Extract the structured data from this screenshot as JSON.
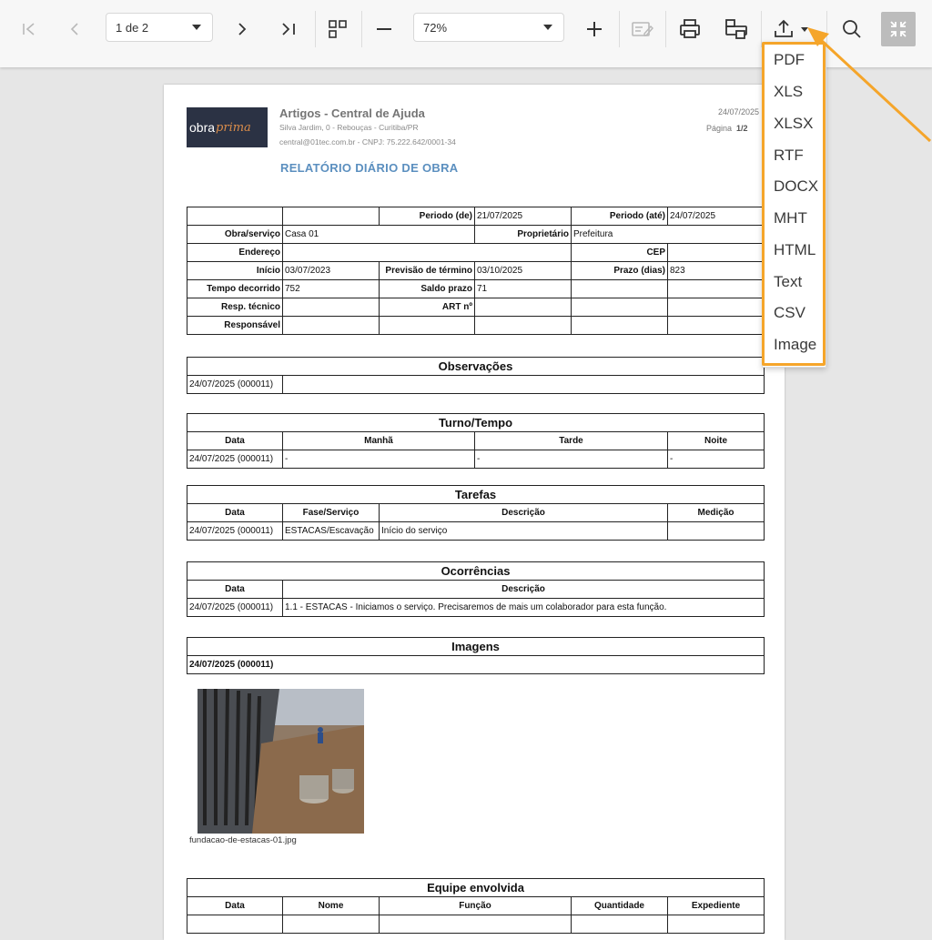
{
  "toolbar": {
    "page_select": "1 de 2",
    "zoom_select": "72%"
  },
  "export_menu": {
    "items": [
      "PDF",
      "XLS",
      "XLSX",
      "RTF",
      "DOCX",
      "MHT",
      "HTML",
      "Text",
      "CSV",
      "Image"
    ]
  },
  "report": {
    "logo_part1": "obra",
    "logo_part2": "prima",
    "company": "Artigos - Central de Ajuda",
    "address": "Silva Jardim, 0 - Rebouças - Curitiba/PR",
    "contact": "central@01tec.com.br - CNPJ: 75.222.642/0001-34",
    "title": "RELATÓRIO DIÁRIO DE OBRA",
    "header_date": "24/07/2025",
    "page_label": "Página",
    "page_num": "1/2",
    "info": {
      "periodo_de_label": "Periodo (de)",
      "periodo_de": "21/07/2025",
      "periodo_ate_label": "Periodo (até)",
      "periodo_ate": "24/07/2025",
      "obra_label": "Obra/serviço",
      "obra": "Casa 01",
      "proprietario_label": "Proprietário",
      "proprietario": "Prefeitura",
      "endereco_label": "Endereço",
      "cep_label": "CEP",
      "inicio_label": "Início",
      "inicio": "03/07/2023",
      "previsao_label": "Previsão de término",
      "previsao": "03/10/2025",
      "prazo_label": "Prazo (dias)",
      "prazo": "823",
      "tempo_label": "Tempo decorrido",
      "tempo": "752",
      "saldo_label": "Saldo prazo",
      "saldo": "71",
      "resp_label": "Resp. técnico",
      "art_label": "ART nº",
      "responsavel_label": "Responsável"
    },
    "observacoes": {
      "title": "Observações",
      "row_date": "24/07/2025 (000011)"
    },
    "turno": {
      "title": "Turno/Tempo",
      "headers": [
        "Data",
        "Manhã",
        "Tarde",
        "Noite"
      ],
      "row": [
        "24/07/2025 (000011)",
        "-",
        "-",
        "-"
      ]
    },
    "tarefas": {
      "title": "Tarefas",
      "headers": [
        "Data",
        "Fase/Serviço",
        "Descrição",
        "Medição"
      ],
      "row": [
        "24/07/2025 (000011)",
        "ESTACAS/Escavação",
        "Início do serviço",
        ""
      ]
    },
    "ocorrencias": {
      "title": "Ocorrências",
      "headers": [
        "Data",
        "Descrição"
      ],
      "row": [
        "24/07/2025 (000011)",
        "1.1 - ESTACAS - Iniciamos o serviço. Precisaremos de mais um colaborador para esta função."
      ]
    },
    "imagens": {
      "title": "Imagens",
      "date": "24/07/2025 (000011)",
      "caption": "fundacao-de-estacas-01.jpg"
    },
    "equipe": {
      "title": "Equipe envolvida",
      "headers": [
        "Data",
        "Nome",
        "Função",
        "Quantidade",
        "Expediente"
      ]
    }
  }
}
